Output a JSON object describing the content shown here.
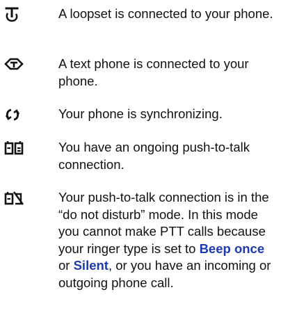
{
  "entries": [
    {
      "icon": "loopset-icon",
      "text": "A loopset is connected to your phone."
    },
    {
      "icon": "text-phone-icon",
      "text": "A text phone is connected to your phone."
    },
    {
      "icon": "synchronizing-icon",
      "text": "Your phone is synchronizing."
    },
    {
      "icon": "push-to-talk-connection-icon",
      "text": "You have an ongoing push-to-talk connection."
    },
    {
      "icon": "push-to-talk-do-not-disturb-icon",
      "text_before": "Your push-to-talk connection is in the “do not disturb” mode. In this mode you cannot make PTT calls because your ringer type is set to ",
      "keyword_1": "Beep once",
      "text_middle": " or ",
      "keyword_2": "Silent",
      "text_after": ", or you have an incoming or outgoing phone call."
    }
  ],
  "colors": {
    "text": "#111111",
    "keyword": "#1f3aa8",
    "icon": "#111111"
  }
}
